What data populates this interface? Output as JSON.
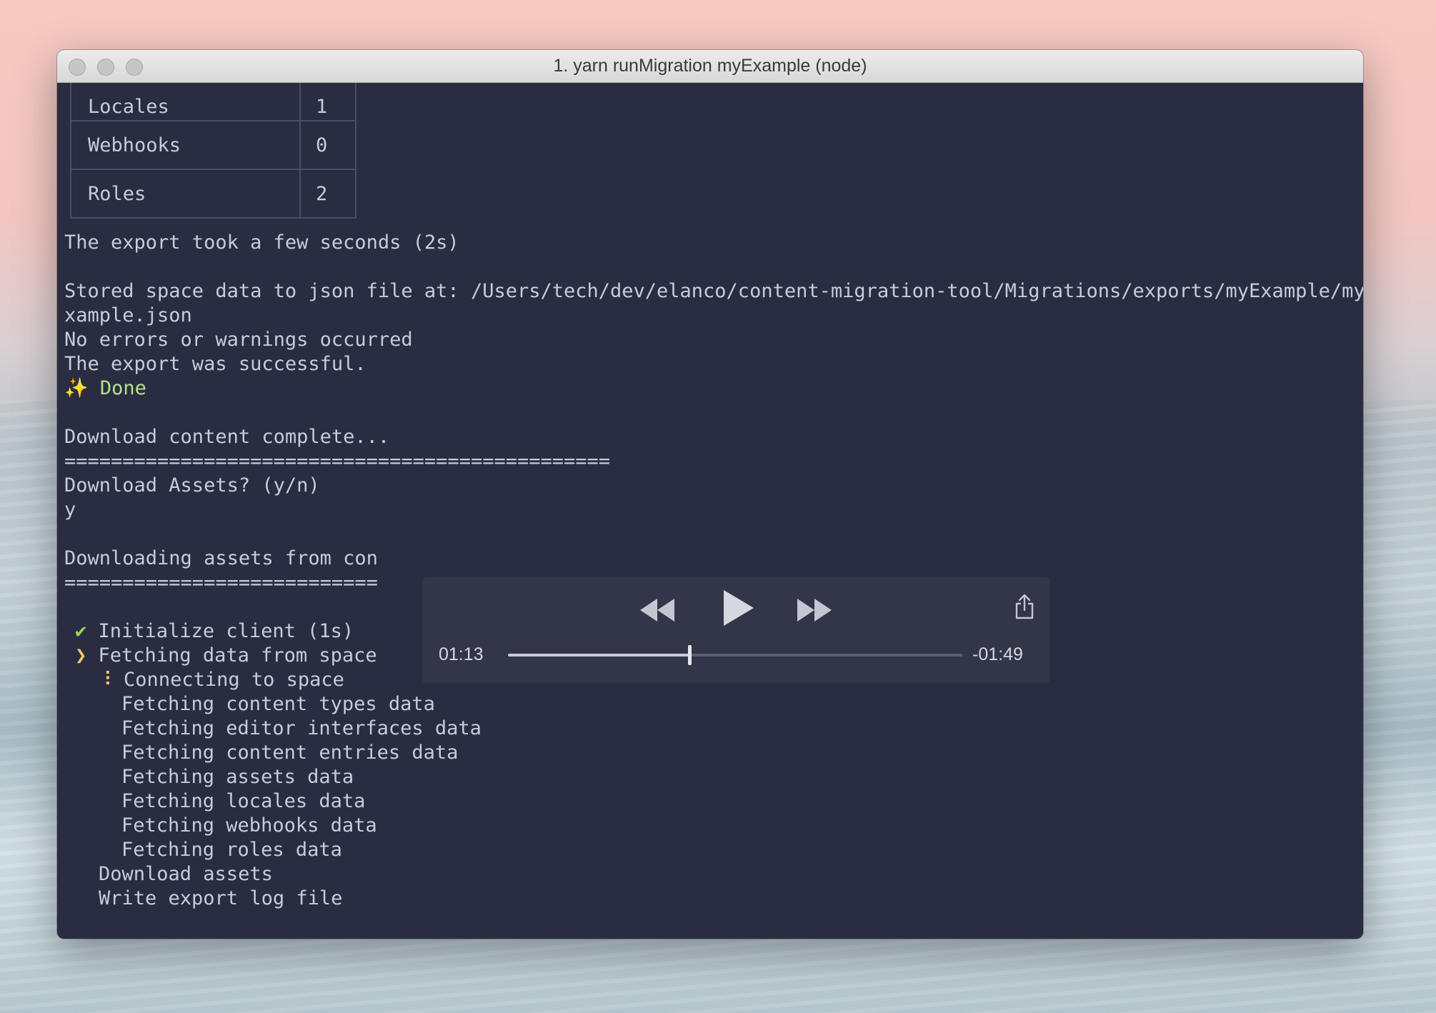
{
  "window": {
    "title": "1. yarn runMigration myExample (node)"
  },
  "table": {
    "rows": [
      {
        "label": "Locales",
        "value": "1"
      },
      {
        "label": "Webhooks",
        "value": "0"
      },
      {
        "label": "Roles",
        "value": "2"
      }
    ]
  },
  "output": {
    "export_time": "The export took a few seconds (2s)",
    "stored_line1": "Stored space data to json file at: /Users/tech/dev/elanco/content-migration-tool/Migrations/exports/myExample/myE",
    "stored_line2": "xample.json",
    "no_errors": "No errors or warnings occurred",
    "success": "The export was successful.",
    "done_icon": "✨",
    "done": "Done",
    "download_complete": "Download content complete...",
    "separator1": "===============================================",
    "download_prompt": "Download Assets? (y/n)",
    "answer": "y",
    "downloading": "Downloading assets from con",
    "separator2": "==========================="
  },
  "tasks": {
    "check_icon": "✔",
    "arrow_icon": "❯",
    "spinner_icon": "⠸",
    "initialize": "Initialize client (1s)",
    "fetching_space": "Fetching data from space",
    "connecting": "Connecting to space",
    "subtasks": [
      "Fetching content types data",
      "Fetching editor interfaces data",
      "Fetching content entries data",
      "Fetching assets data",
      "Fetching locales data",
      "Fetching webhooks data",
      "Fetching roles data"
    ],
    "download_assets": "Download assets",
    "write_log": "Write export log file"
  },
  "player": {
    "elapsed": "01:13",
    "remaining": "-01:49",
    "progress": 0.4,
    "icons": {
      "rewind": "rewind-icon",
      "play": "play-icon",
      "fast_forward": "fast-forward-icon",
      "share": "share-icon"
    }
  },
  "colors": {
    "terminal_bg": "#2a2d41",
    "terminal_text": "#c8cbda",
    "done_green": "#b5e28a",
    "arrow_yellow": "#f4c66a",
    "check_green": "#9bd45b"
  }
}
